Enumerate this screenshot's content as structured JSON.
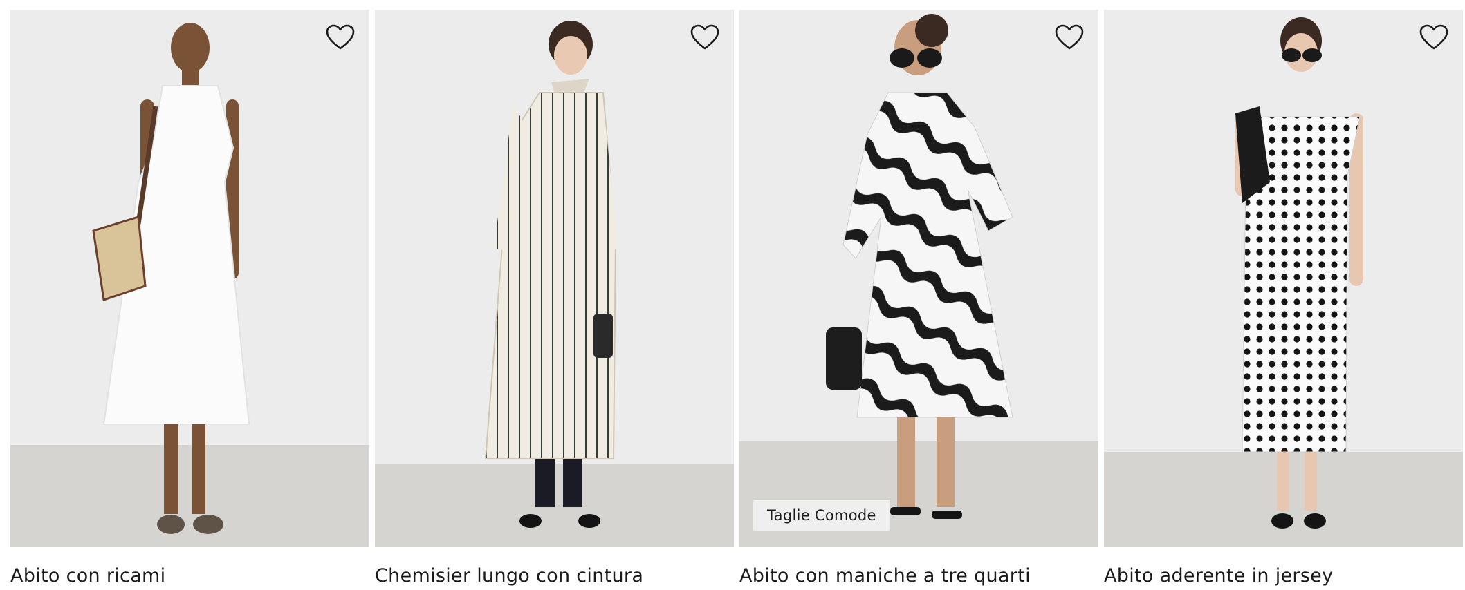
{
  "products": [
    {
      "title": "Abito con ricami",
      "favorite_icon": "heart-outline-icon",
      "badge": ""
    },
    {
      "title": "Chemisier lungo con cintura",
      "favorite_icon": "heart-outline-icon",
      "badge": ""
    },
    {
      "title": "Abito con maniche a tre quarti",
      "favorite_icon": "heart-outline-icon",
      "badge": "Taglie Comode"
    },
    {
      "title": "Abito aderente in jersey",
      "favorite_icon": "heart-outline-icon",
      "badge": ""
    }
  ],
  "colors": {
    "background": "#ffffff",
    "wall": "#ececec",
    "floor": "#d6d4d1",
    "text": "#1a1a1a",
    "badge_bg": "#f0f0f0"
  }
}
